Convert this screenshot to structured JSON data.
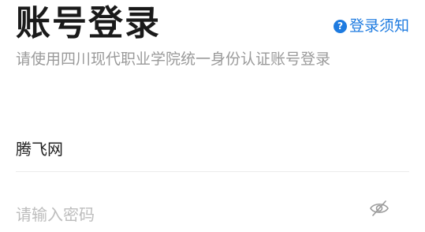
{
  "header": {
    "title": "账号登录",
    "notice_link": "登录须知",
    "subtitle": "请使用四川现代职业学院统一身份认证账号登录"
  },
  "form": {
    "username_value": "腾飞网",
    "password_placeholder": "请输入密码"
  },
  "icons": {
    "help": "question-circle-icon",
    "password_toggle": "eye-slash-icon"
  },
  "colors": {
    "accent": "#1e7be0",
    "title": "#1a1a1a",
    "subtitle": "#9a9a9a",
    "placeholder": "#bdbdbd",
    "divider": "#ececec"
  }
}
